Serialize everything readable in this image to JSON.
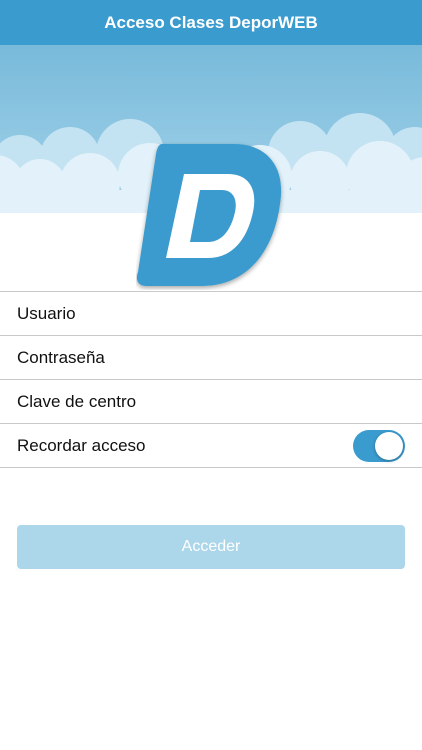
{
  "header": {
    "title": "Acceso Clases DeporWEB"
  },
  "logo": {
    "letter": "D",
    "color": "#3a9bce"
  },
  "form": {
    "user_placeholder": "Usuario",
    "password_placeholder": "Contraseña",
    "center_key_placeholder": "Clave de centro",
    "remember_label": "Recordar acceso",
    "remember_on": true
  },
  "submit": {
    "label": "Acceder"
  },
  "colors": {
    "accent": "#3a9bce",
    "submit_disabled": "#acd6ea",
    "sky_top": "#7bbcdb",
    "sky_bottom": "#a6d4ea",
    "clouds": "#e1f1f9"
  }
}
